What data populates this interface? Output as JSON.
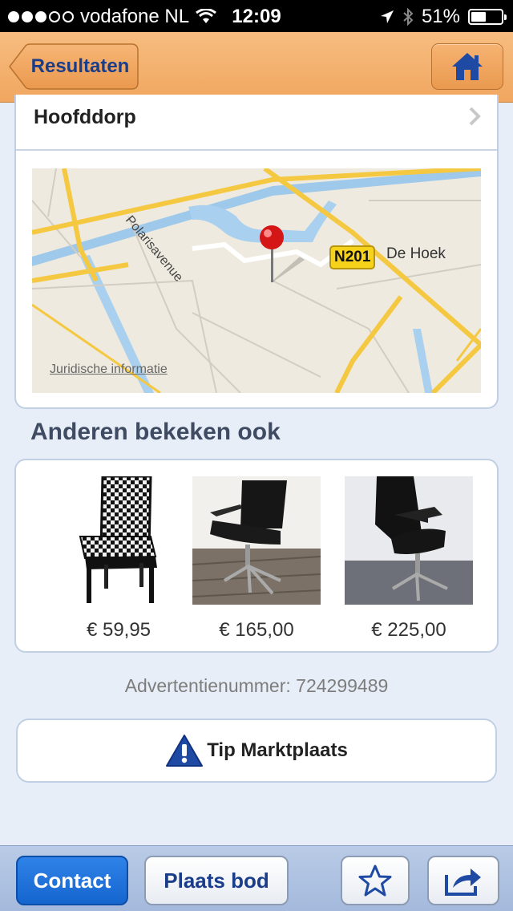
{
  "status_bar": {
    "carrier": "vodafone NL",
    "time": "12:09",
    "battery": "51%",
    "battery_level": 0.51
  },
  "nav": {
    "back_label": "Resultaten",
    "home_icon": "home-icon"
  },
  "location": {
    "city": "Hoofddorp"
  },
  "map": {
    "road_label": "N201",
    "place_label": "De Hoek",
    "street_label": "Polarisavenue",
    "legal_link": "Juridische informatie"
  },
  "related": {
    "title": "Anderen bekeken ook",
    "items": [
      {
        "price": "€ 59,95",
        "image": "patterned dining chair"
      },
      {
        "price": "€ 165,00",
        "image": "black office chair"
      },
      {
        "price": "€ 225,00",
        "image": "black office chair"
      }
    ]
  },
  "ad_number": "Advertentienummer: 724299489",
  "tip_button": {
    "label": "Tip Marktplaats",
    "icon": "warning-icon"
  },
  "toolbar": {
    "contact_label": "Contact",
    "bid_label": "Plaats bod",
    "favorite_icon": "star-icon",
    "share_icon": "share-icon"
  },
  "colors": {
    "nav_orange": "#f0a65f",
    "brand_blue": "#1a3d8a",
    "contact_blue": "#1565cf",
    "background": "#e8eef7"
  }
}
